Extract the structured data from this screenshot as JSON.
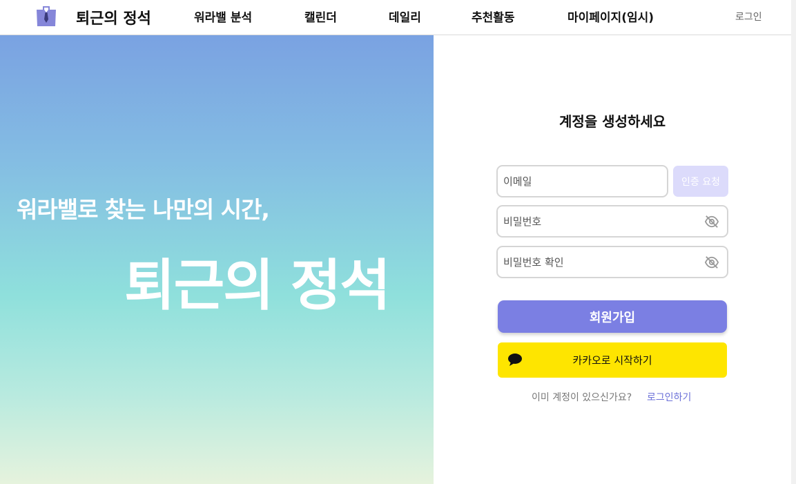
{
  "header": {
    "brand": "퇴근의 정석",
    "nav": [
      "워라밸 분석",
      "캘린더",
      "데일리",
      "추천활동",
      "마이페이지(임시)"
    ],
    "login": "로그인"
  },
  "hero": {
    "subtitle": "워라밸로 찾는 나만의 시간,",
    "title": "퇴근의 정석"
  },
  "form": {
    "title": "계정을 생성하세요",
    "email_placeholder": "이메일",
    "verify_button": "인증 요청",
    "password_placeholder": "비밀번호",
    "password_confirm_placeholder": "비밀번호 확인",
    "signup_button": "회원가입",
    "kakao_button": "카카오로 시작하기",
    "have_account_text": "이미 계정이 있으신가요?",
    "login_link": "로그인하기"
  },
  "colors": {
    "accent": "#7b7fe3",
    "kakao": "#fee500",
    "verify_disabled": "#dcdbfb"
  }
}
